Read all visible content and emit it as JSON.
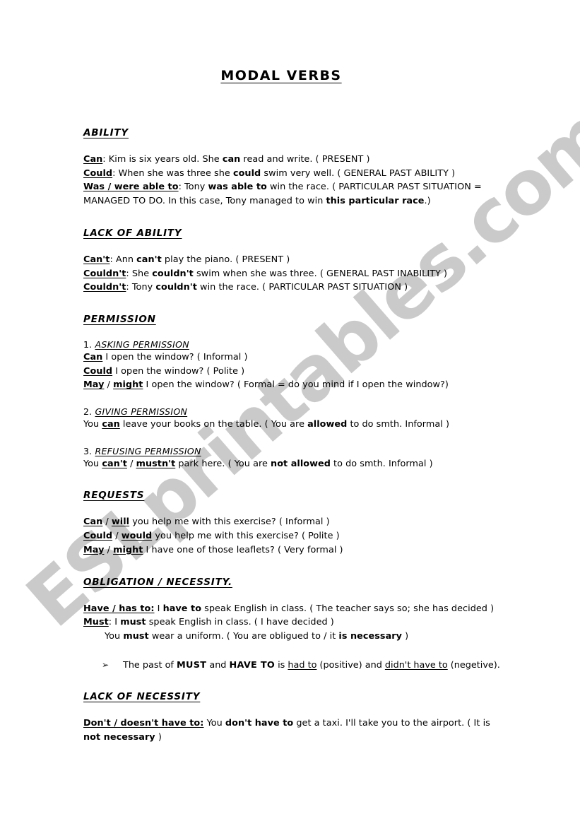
{
  "document": {
    "title": "MODAL VERBS",
    "watermark": "ESLprintables.com",
    "watermark_color": "#cacaca",
    "page_background": "#ffffff",
    "text_color": "#000000"
  },
  "sections": [
    {
      "heading": "ABILITY",
      "lines": [
        {
          "parts": [
            {
              "text": "Can",
              "style": "bold-underline"
            },
            {
              "text": ": Kim is six years old. She ",
              "style": "plain"
            },
            {
              "text": "can",
              "style": "bold"
            },
            {
              "text": " read and write. ( PRESENT )",
              "style": "plain"
            }
          ]
        },
        {
          "parts": [
            {
              "text": "Could",
              "style": "bold-underline"
            },
            {
              "text": ": When she was three she ",
              "style": "plain"
            },
            {
              "text": "could",
              "style": "bold"
            },
            {
              "text": " swim very well. ( GENERAL PAST ABILITY )",
              "style": "plain"
            }
          ]
        },
        {
          "parts": [
            {
              "text": "Was / were able to",
              "style": "bold-underline"
            },
            {
              "text": ": Tony ",
              "style": "plain"
            },
            {
              "text": "was able to",
              "style": "bold"
            },
            {
              "text": " win the race. ( PARTICULAR PAST SITUATION = MANAGED TO DO. In this case, Tony managed to win ",
              "style": "plain"
            },
            {
              "text": "this particular race",
              "style": "bold"
            },
            {
              "text": ".)",
              "style": "plain"
            }
          ]
        }
      ]
    },
    {
      "heading": "LACK OF ABILITY",
      "lines": [
        {
          "parts": [
            {
              "text": "Can't",
              "style": "bold-underline"
            },
            {
              "text": ": Ann ",
              "style": "plain"
            },
            {
              "text": "can't",
              "style": "bold"
            },
            {
              "text": " play the piano. ( PRESENT )",
              "style": "plain"
            }
          ]
        },
        {
          "parts": [
            {
              "text": "Couldn't",
              "style": "bold-underline"
            },
            {
              "text": ": She ",
              "style": "plain"
            },
            {
              "text": "couldn't",
              "style": "bold"
            },
            {
              "text": " swim when she was three. ( GENERAL PAST INABILITY )",
              "style": "plain"
            }
          ]
        },
        {
          "parts": [
            {
              "text": "Couldn't",
              "style": "bold-underline"
            },
            {
              "text": ": Tony ",
              "style": "plain"
            },
            {
              "text": "couldn't",
              "style": "bold"
            },
            {
              "text": " win the race. ( PARTICULAR PAST SITUATION )",
              "style": "plain"
            }
          ]
        }
      ]
    },
    {
      "heading": "PERMISSION",
      "subsections": [
        {
          "number": "1.",
          "sub_heading": "ASKING PERMISSION",
          "lines": [
            {
              "parts": [
                {
                  "text": "Can",
                  "style": "bold-underline"
                },
                {
                  "text": " I open the window? ( Informal )",
                  "style": "plain"
                }
              ]
            },
            {
              "parts": [
                {
                  "text": "Could",
                  "style": "bold-underline"
                },
                {
                  "text": " I open the window? ( Polite )",
                  "style": "plain"
                }
              ]
            },
            {
              "parts": [
                {
                  "text": "May",
                  "style": "bold-underline"
                },
                {
                  "text": " / ",
                  "style": "plain"
                },
                {
                  "text": "might",
                  "style": "bold-underline"
                },
                {
                  "text": " I open the window? ( Formal = do you mind if I open the window?)",
                  "style": "plain"
                }
              ]
            }
          ]
        },
        {
          "number": "2.",
          "sub_heading": "GIVING PERMISSION",
          "lines": [
            {
              "parts": [
                {
                  "text": "You ",
                  "style": "plain"
                },
                {
                  "text": "can",
                  "style": "bold-underline"
                },
                {
                  "text": " leave your books on the table. ( You are ",
                  "style": "plain"
                },
                {
                  "text": "allowed",
                  "style": "bold"
                },
                {
                  "text": " to do smth. Informal )",
                  "style": "plain"
                }
              ]
            }
          ]
        },
        {
          "number": "3.",
          "sub_heading": "REFUSING PERMISSION",
          "lines": [
            {
              "parts": [
                {
                  "text": "You ",
                  "style": "plain"
                },
                {
                  "text": "can't",
                  "style": "bold-underline"
                },
                {
                  "text": " / ",
                  "style": "plain"
                },
                {
                  "text": "mustn't",
                  "style": "bold-underline"
                },
                {
                  "text": " park here. ( You are ",
                  "style": "plain"
                },
                {
                  "text": "not allowed",
                  "style": "bold"
                },
                {
                  "text": " to do smth. Informal )",
                  "style": "plain"
                }
              ]
            }
          ]
        }
      ]
    },
    {
      "heading": "REQUESTS",
      "lines": [
        {
          "parts": [
            {
              "text": "Can",
              "style": "bold-underline"
            },
            {
              "text": " / ",
              "style": "plain"
            },
            {
              "text": "will",
              "style": "bold-underline"
            },
            {
              "text": " you help me with this exercise? ( Informal )",
              "style": "plain"
            }
          ]
        },
        {
          "parts": [
            {
              "text": "Could",
              "style": "bold-underline"
            },
            {
              "text": " / ",
              "style": "plain"
            },
            {
              "text": "would",
              "style": "bold-underline"
            },
            {
              "text": " you help me with this exercise? ( Polite )",
              "style": "plain"
            }
          ]
        },
        {
          "parts": [
            {
              "text": "May",
              "style": "bold-underline"
            },
            {
              "text": " / ",
              "style": "plain"
            },
            {
              "text": "might",
              "style": "bold-underline"
            },
            {
              "text": " I have one of those leaflets? ( Very formal )",
              "style": "plain"
            }
          ]
        }
      ]
    },
    {
      "heading": "OBLIGATION / NECESSITY.",
      "lines": [
        {
          "parts": [
            {
              "text": "Have / has to:",
              "style": "bold-underline"
            },
            {
              "text": "  I ",
              "style": "plain"
            },
            {
              "text": "have to",
              "style": "bold"
            },
            {
              "text": " speak English in class. ( The teacher says so; she has decided )",
              "style": "plain"
            }
          ]
        },
        {
          "parts": [
            {
              "text": "Must",
              "style": "bold-underline"
            },
            {
              "text": ": I ",
              "style": "plain"
            },
            {
              "text": "must",
              "style": "bold"
            },
            {
              "text": " speak English in class. ( I have decided )",
              "style": "plain"
            }
          ]
        },
        {
          "indent": true,
          "parts": [
            {
              "text": "You ",
              "style": "plain"
            },
            {
              "text": "must",
              "style": "bold"
            },
            {
              "text": " wear a uniform. ( You are obligued to / it ",
              "style": "plain"
            },
            {
              "text": "is necessary",
              "style": "bold"
            },
            {
              "text": " )",
              "style": "plain"
            }
          ]
        }
      ],
      "bullet": {
        "glyph": "➢",
        "glyph_name": "arrowhead-bullet",
        "parts": [
          {
            "text": "The past of ",
            "style": "plain"
          },
          {
            "text": "MUST",
            "style": "bold-caps"
          },
          {
            "text": " and ",
            "style": "plain"
          },
          {
            "text": "HAVE TO",
            "style": "bold-caps"
          },
          {
            "text": " is ",
            "style": "plain"
          },
          {
            "text": "had to",
            "style": "underline"
          },
          {
            "text": " (positive) and ",
            "style": "plain"
          },
          {
            "text": "didn't have to",
            "style": "underline"
          },
          {
            "text": " (negetive).",
            "style": "plain"
          }
        ]
      }
    },
    {
      "heading": "LACK OF NECESSITY",
      "lines": [
        {
          "parts": [
            {
              "text": "Don't / doesn't have to:",
              "style": "bold-underline"
            },
            {
              "text": "  You ",
              "style": "plain"
            },
            {
              "text": "don't have to",
              "style": "bold"
            },
            {
              "text": " get a taxi. I'll take you to the airport. ( It is ",
              "style": "plain"
            },
            {
              "text": "not necessary",
              "style": "bold"
            },
            {
              "text": " )",
              "style": "plain"
            }
          ]
        }
      ]
    }
  ]
}
